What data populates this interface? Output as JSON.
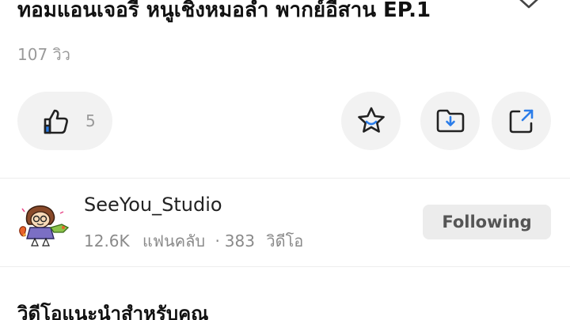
{
  "video": {
    "title": "ทอมแอนเจอรี หนูเชิงหมอลำ พากย์อีสาน EP.1",
    "views": "107 วิว",
    "expand_icon": "chevron-down-icon"
  },
  "actions": {
    "like_count": "5",
    "like_icon": "thumbs-up-icon",
    "favorite_icon": "star-icon",
    "save_icon": "folder-download-icon",
    "share_icon": "share-external-icon"
  },
  "channel": {
    "name": "SeeYou_Studio",
    "fans_count": "12.6K",
    "fans_label": "แฟนคลับ",
    "separator": "·",
    "videos_count": "383",
    "videos_label": "วิดีโอ",
    "follow_button": "Following"
  },
  "recommendations": {
    "title": "วิดีโอแนะนำสำหรับคุณ"
  },
  "colors": {
    "accent_blue": "#2b7de9",
    "pill_bg": "#f2f2f2",
    "button_bg": "#ececec"
  }
}
